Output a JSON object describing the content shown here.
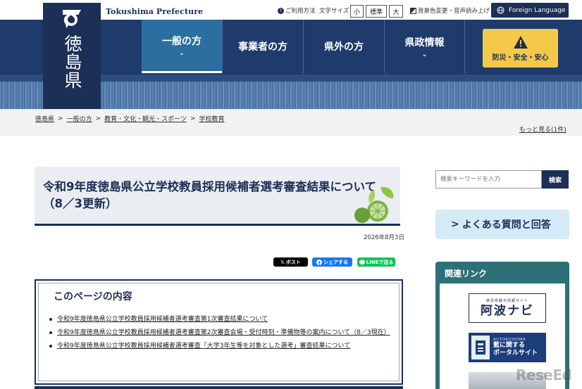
{
  "topbar": {
    "brand_en": "Tokushima Prefecture",
    "help": "ご利用方法",
    "font_size_label": "文字サイズ",
    "font_small": "小",
    "font_standard": "標準",
    "font_large": "大",
    "color_speech": "背景色変更・音声読み上げ",
    "foreign_language": "Foreign Language"
  },
  "header": {
    "logo_text": "徳島県",
    "nav": [
      {
        "label": "一般の方",
        "chevron": "⌄"
      },
      {
        "label": "事業者の方"
      },
      {
        "label": "県外の方"
      },
      {
        "label": "県政情報",
        "chevron": "⌄"
      }
    ],
    "bousai": "防災・安全・安心"
  },
  "breadcrumb": {
    "items": [
      "徳島県",
      "一般の方",
      "教育・文化・観光・スポーツ",
      "学校教育"
    ],
    "separator": ">",
    "more": "もっと見る(1件)"
  },
  "main": {
    "title": "令和9年度徳島県公立学校教員採用候補者選考審査結果について（8／3更新）",
    "date": "2026年8月3日",
    "share": {
      "x": "ポスト",
      "facebook": "シェアする",
      "line": "LINEで送る"
    },
    "toc": {
      "title": "このページの内容",
      "items": [
        "令和9年度徳島県公立学校教員採用候補者選考審査第1次審査結果について",
        "令和9年度徳島県公立学校教員採用候補者選考審査第2次審査会場・受付時刻・準備物等の案内について（8／3現在）",
        "令和9年度徳島県公立学校教員採用候補者選考審査「大学3年生等を対象とした選考」審査結果について"
      ]
    }
  },
  "sidebar": {
    "search_placeholder": "検索キーワードを入力",
    "search_button": "検索",
    "faq": "よくある質問と回答",
    "faq_arrow": ">",
    "related_title": "関連リンク",
    "banner_awa_sub": "徳島県観光情報サイト",
    "banner_awa_main": "阿波ナビ",
    "banner_ai_head": "AI/TOKUSHIMA",
    "banner_ai_line1": "藍に関する",
    "banner_ai_line2": "ポータルサイト"
  },
  "watermark": "ReseEd",
  "colors": {
    "navy": "#1c2f56",
    "nav_active": "#2b6fa1",
    "bousai": "#f5c84a",
    "faq_bg": "#d5eaf7",
    "related": "#2e7078"
  }
}
